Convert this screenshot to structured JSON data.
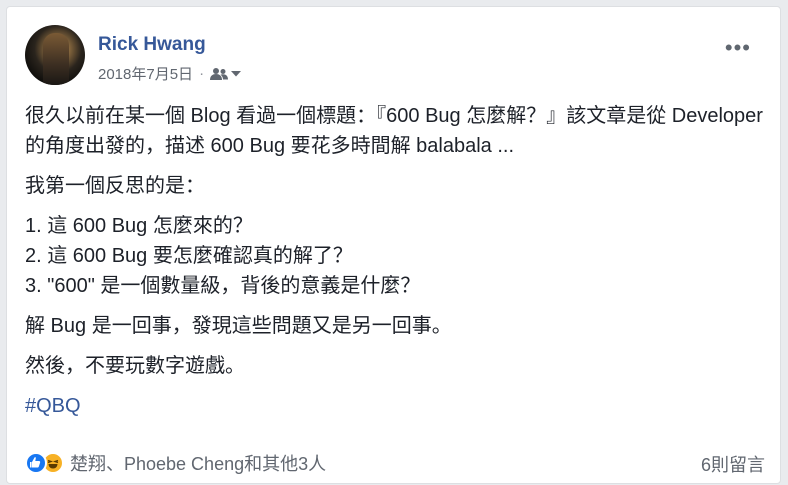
{
  "post": {
    "author": "Rick Hwang",
    "date": "2018年7月5日",
    "separator": "·",
    "audience_icon": "friends-icon",
    "more_icon": "more-options-icon",
    "more_label": "•••",
    "paragraphs": [
      "很久以前在某一個 Blog 看過一個標題：『600 Bug 怎麼解？』該文章是從 Developer 的角度出發的，描述 600 Bug 要花多時間解 balabala ...",
      "我第一個反思的是："
    ],
    "list": [
      "1. 這 600 Bug 怎麼來的？",
      "2. 這 600 Bug 要怎麼確認真的解了？",
      "3. \"600\" 是一個數量級，背後的意義是什麼？"
    ],
    "closing": [
      "解 Bug 是一回事，發現這些問題又是另一回事。",
      "然後，不要玩數字遊戲。"
    ],
    "hashtag": "#QBQ"
  },
  "footer": {
    "reactions": [
      "like-icon",
      "haha-icon"
    ],
    "reaction_names": "楚翔、Phoebe Cheng和其他3人",
    "comments": "6則留言"
  },
  "colors": {
    "link": "#365899",
    "text": "#1d2129",
    "meta": "#616770",
    "like": "#1877f2",
    "haha": "#f7b125"
  }
}
